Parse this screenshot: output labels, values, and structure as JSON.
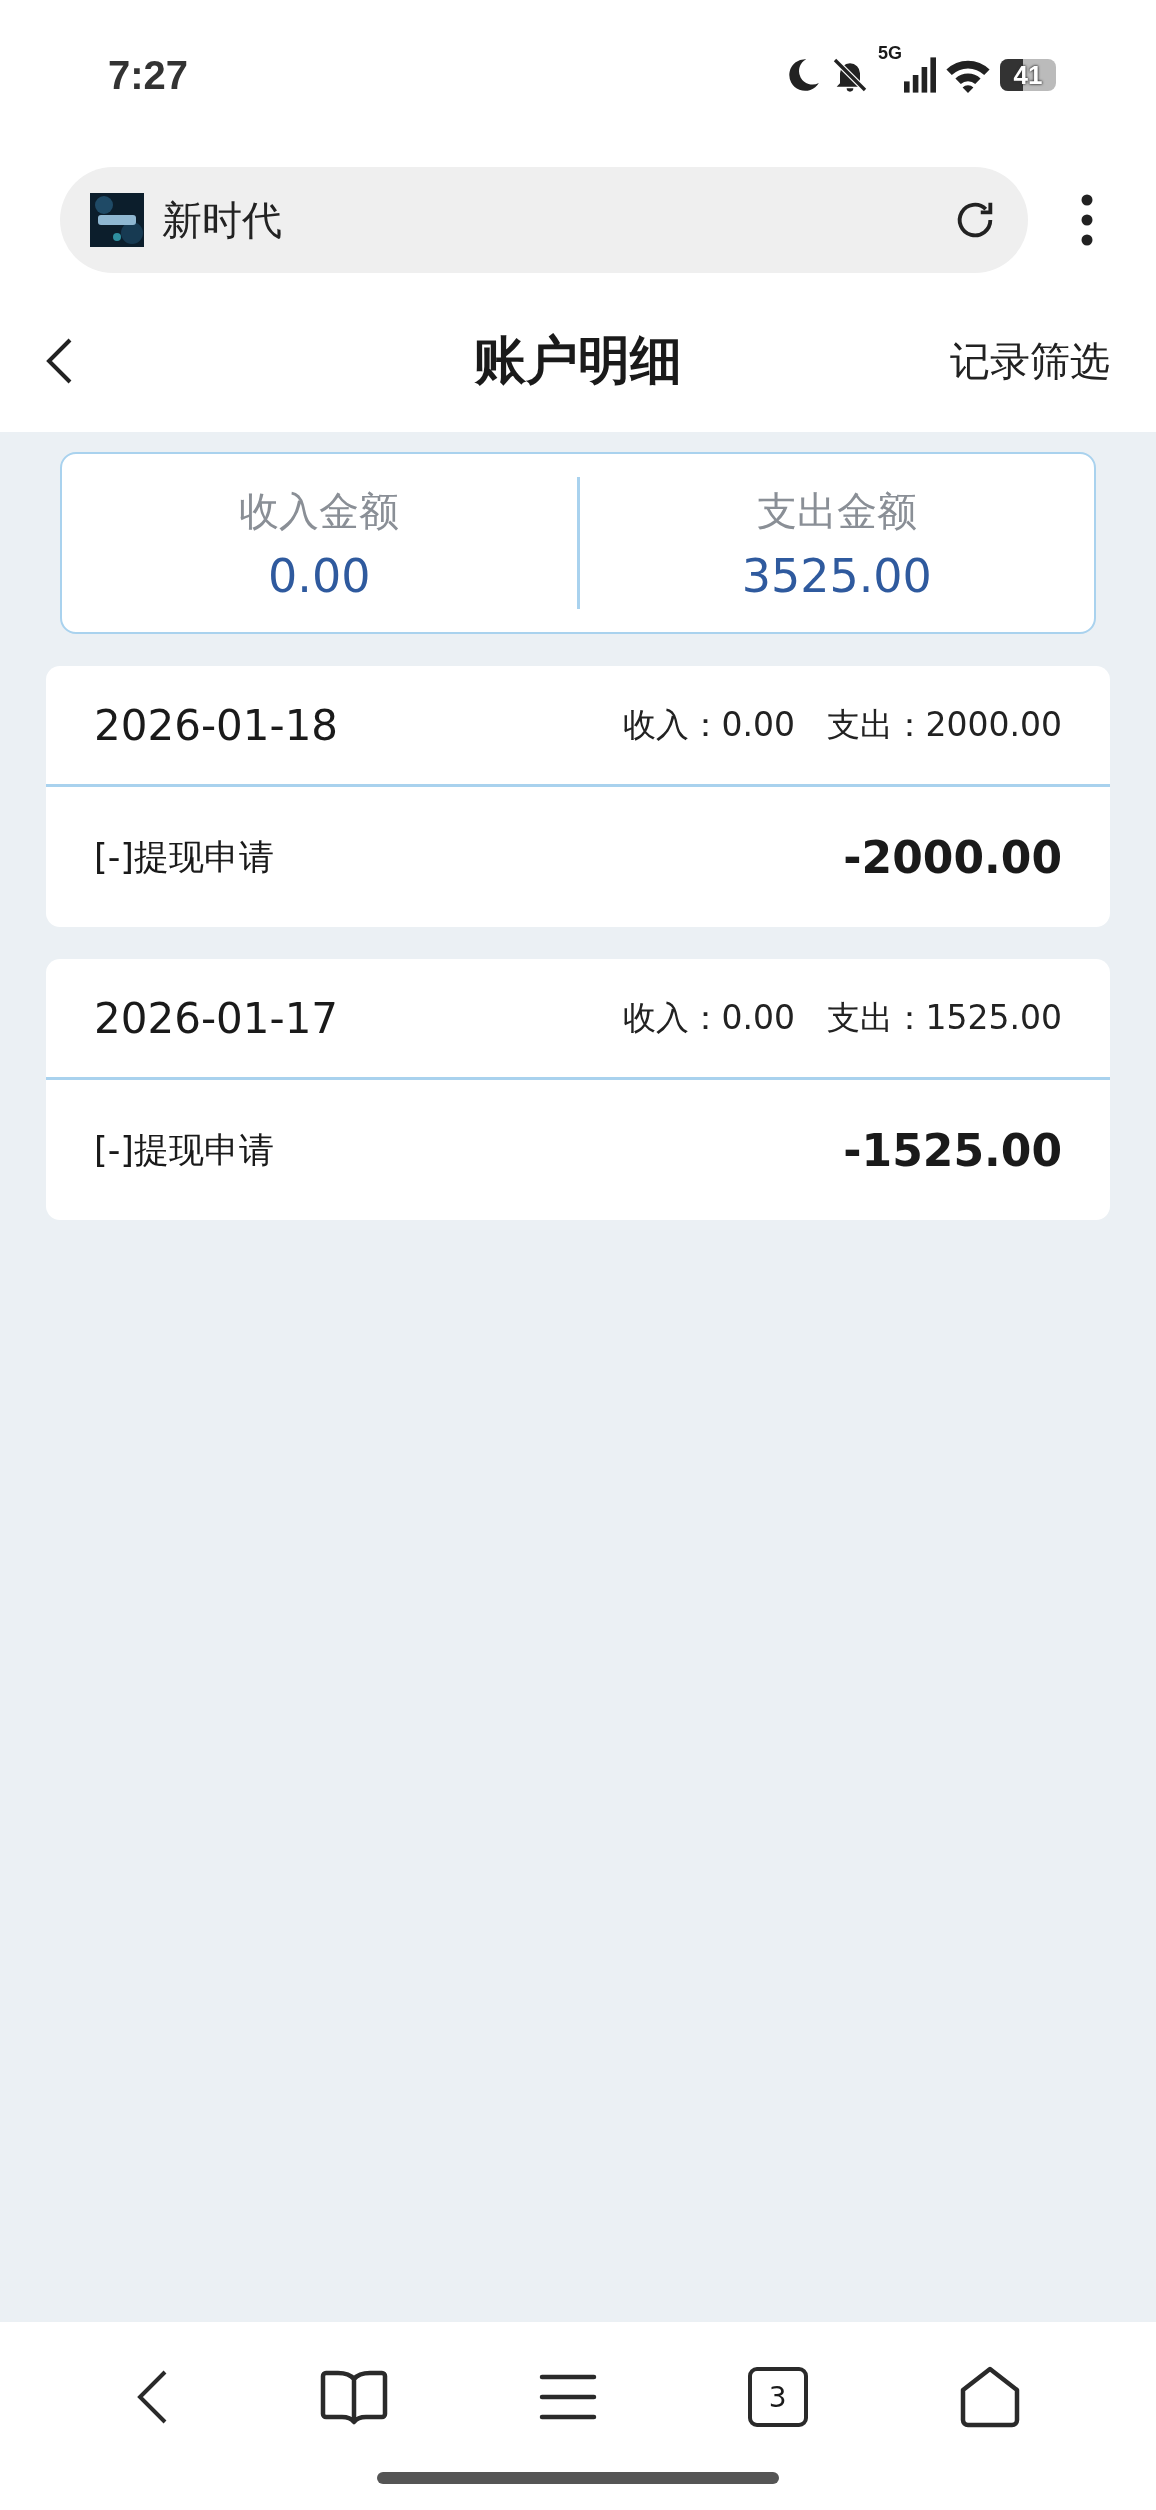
{
  "status_bar": {
    "time": "7:27",
    "network": "5G",
    "battery": "41"
  },
  "browser": {
    "site_title": "新时代",
    "tab_count": "3"
  },
  "header": {
    "title": "账户明细",
    "action": "记录筛选"
  },
  "summary": [
    {
      "label": "收入金额",
      "value": "0.00"
    },
    {
      "label": "支出金额",
      "value": "3525.00"
    }
  ],
  "days": [
    {
      "date": "2026-01-18",
      "income_label": "收入：",
      "income": "0.00",
      "expense_label": "支出：",
      "expense": "2000.00",
      "entries": [
        {
          "title": "[-]提现申请",
          "amount": "-2000.00"
        }
      ]
    },
    {
      "date": "2026-01-17",
      "income_label": "收入：",
      "income": "0.00",
      "expense_label": "支出：",
      "expense": "1525.00",
      "entries": [
        {
          "title": "[-]提现申请",
          "amount": "-1525.00"
        }
      ]
    }
  ]
}
